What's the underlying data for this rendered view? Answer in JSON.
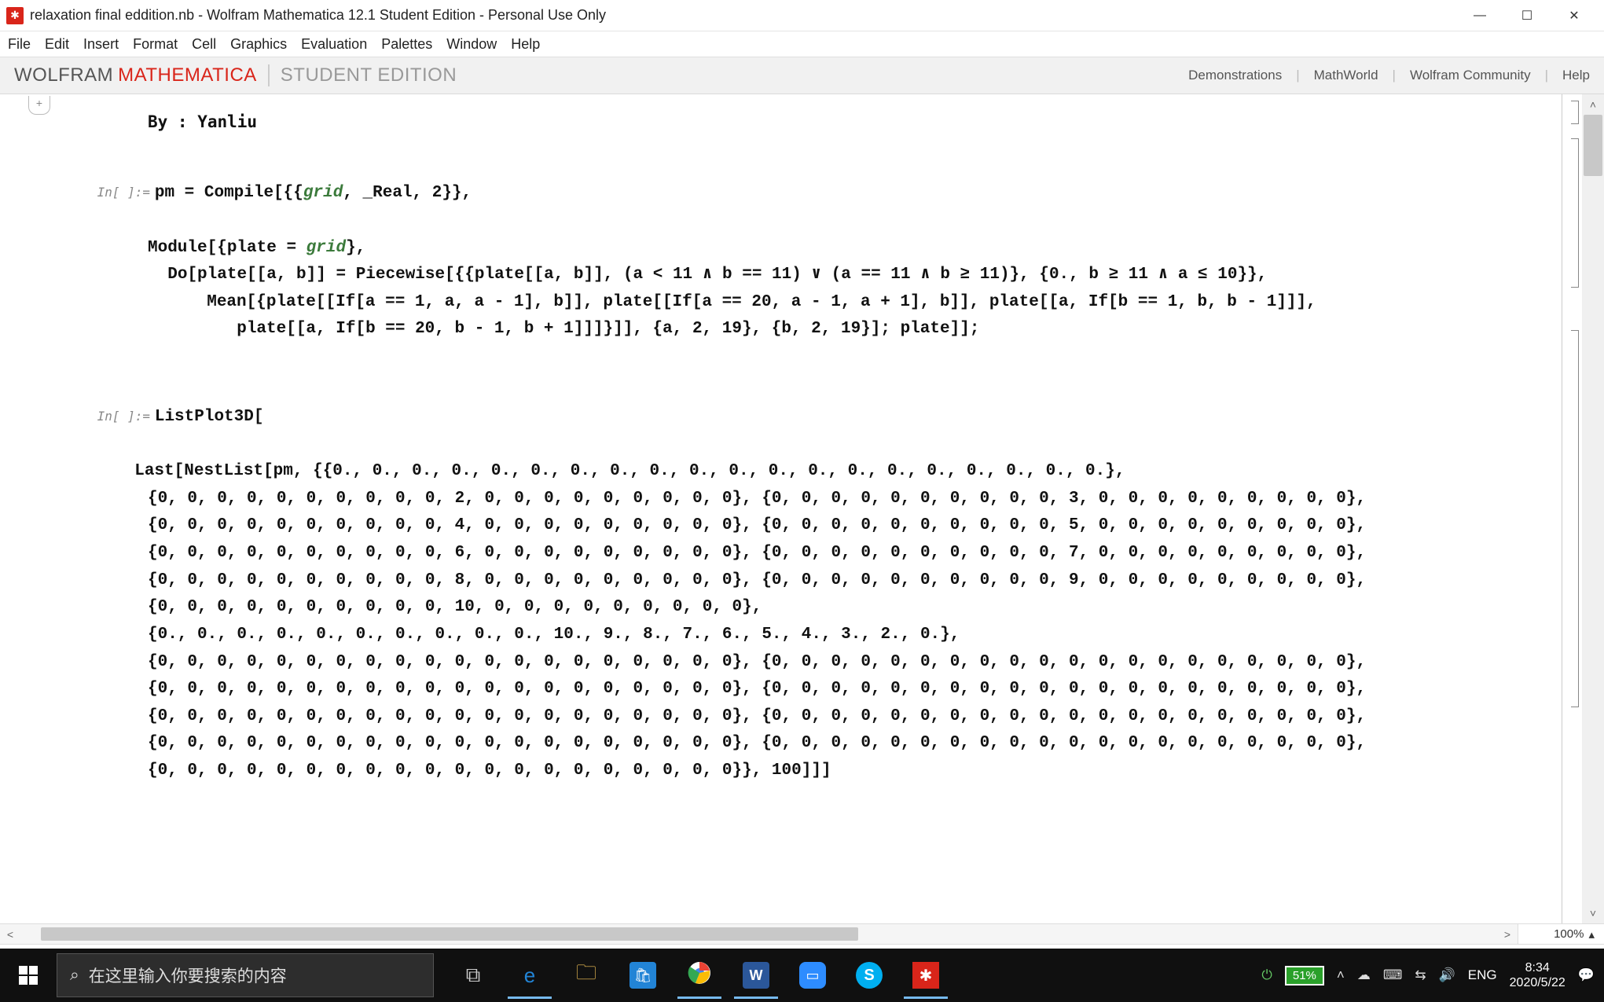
{
  "window": {
    "title": "relaxation final eddition.nb - Wolfram Mathematica 12.1 Student Edition - Personal Use Only",
    "controls": {
      "min": "—",
      "max": "☐",
      "close": "✕"
    }
  },
  "menu": [
    "File",
    "Edit",
    "Insert",
    "Format",
    "Cell",
    "Graphics",
    "Evaluation",
    "Palettes",
    "Window",
    "Help"
  ],
  "brand": {
    "w1": "WOLFRAM",
    "w2": "MATHEMATICA",
    "w3": "STUDENT EDITION"
  },
  "header_links": [
    "Demonstrations",
    "MathWorld",
    "Wolfram Community",
    "Help"
  ],
  "notebook": {
    "byline": "By : Yanliu",
    "in_label": "In[ ]:=",
    "cell1": {
      "l1a": "pm = ",
      "l1b": "Compile",
      "l1c": "[{{",
      "l1d": "grid",
      "l1e": ", _Real, 2}},",
      "l2a": "Module",
      "l2b": "[{plate = ",
      "l2c": "grid",
      "l2d": "},",
      "l3a": "Do",
      "l3b": "[plate[[a, b]] = ",
      "l3c": "Piecewise",
      "l3d": "[{{plate[[a, b]], (a < 11 ∧ b == 11) ∨ (a == 11 ∧ b ≥ 11)}, {0., b ≥ 11 ∧ a ≤ 10}},",
      "l4a": "Mean",
      "l4b": "[{plate[[",
      "l4c": "If",
      "l4d": "[a == 1, a, a - 1], b]], plate[[",
      "l4e": "If",
      "l4f": "[a == 20, a - 1, a + 1], b]], plate[[a, ",
      "l4g": "If",
      "l4h": "[b == 1, b, b - 1]]],",
      "l5a": "plate[[a, ",
      "l5b": "If",
      "l5c": "[b == 20, b - 1, b + 1]]]}]], {a, 2, 19}, {b, 2, 19}]; plate]];"
    },
    "cell2": {
      "l1": "ListPlot3D[",
      "l2a": "Last",
      "l2b": "[",
      "l2c": "NestList",
      "l2d": "[pm, {{0., 0., 0., 0., 0., 0., 0., 0., 0., 0., 0., 0., 0., 0., 0., 0., 0., 0., 0., 0.},",
      "l3": "{0, 0, 0, 0, 0, 0, 0, 0, 0, 0, 2, 0, 0, 0, 0, 0, 0, 0, 0, 0}, {0, 0, 0, 0, 0, 0, 0, 0, 0, 0, 3, 0, 0, 0, 0, 0, 0, 0, 0, 0},",
      "l4": "{0, 0, 0, 0, 0, 0, 0, 0, 0, 0, 4, 0, 0, 0, 0, 0, 0, 0, 0, 0}, {0, 0, 0, 0, 0, 0, 0, 0, 0, 0, 5, 0, 0, 0, 0, 0, 0, 0, 0, 0},",
      "l5": "{0, 0, 0, 0, 0, 0, 0, 0, 0, 0, 6, 0, 0, 0, 0, 0, 0, 0, 0, 0}, {0, 0, 0, 0, 0, 0, 0, 0, 0, 0, 7, 0, 0, 0, 0, 0, 0, 0, 0, 0},",
      "l6": "{0, 0, 0, 0, 0, 0, 0, 0, 0, 0, 8, 0, 0, 0, 0, 0, 0, 0, 0, 0}, {0, 0, 0, 0, 0, 0, 0, 0, 0, 0, 9, 0, 0, 0, 0, 0, 0, 0, 0, 0},",
      "l7": "{0, 0, 0, 0, 0, 0, 0, 0, 0, 0, 10, 0, 0, 0, 0, 0, 0, 0, 0, 0},",
      "l8": "{0., 0., 0., 0., 0., 0., 0., 0., 0., 0., 10., 9., 8., 7., 6., 5., 4., 3., 2., 0.},",
      "l9": "{0, 0, 0, 0, 0, 0, 0, 0, 0, 0, 0, 0, 0, 0, 0, 0, 0, 0, 0, 0}, {0, 0, 0, 0, 0, 0, 0, 0, 0, 0, 0, 0, 0, 0, 0, 0, 0, 0, 0, 0},",
      "l10": "{0, 0, 0, 0, 0, 0, 0, 0, 0, 0, 0, 0, 0, 0, 0, 0, 0, 0, 0, 0}, {0, 0, 0, 0, 0, 0, 0, 0, 0, 0, 0, 0, 0, 0, 0, 0, 0, 0, 0, 0},",
      "l11": "{0, 0, 0, 0, 0, 0, 0, 0, 0, 0, 0, 0, 0, 0, 0, 0, 0, 0, 0, 0}, {0, 0, 0, 0, 0, 0, 0, 0, 0, 0, 0, 0, 0, 0, 0, 0, 0, 0, 0, 0},",
      "l12": "{0, 0, 0, 0, 0, 0, 0, 0, 0, 0, 0, 0, 0, 0, 0, 0, 0, 0, 0, 0}, {0, 0, 0, 0, 0, 0, 0, 0, 0, 0, 0, 0, 0, 0, 0, 0, 0, 0, 0, 0},",
      "l13": "{0, 0, 0, 0, 0, 0, 0, 0, 0, 0, 0, 0, 0, 0, 0, 0, 0, 0, 0, 0}}, 100]]]"
    }
  },
  "zoom": "100%",
  "taskbar": {
    "search_placeholder": "在这里输入你要搜索的内容",
    "battery": "51%",
    "lang": "ENG",
    "time": "8:34",
    "date": "2020/5/22"
  }
}
